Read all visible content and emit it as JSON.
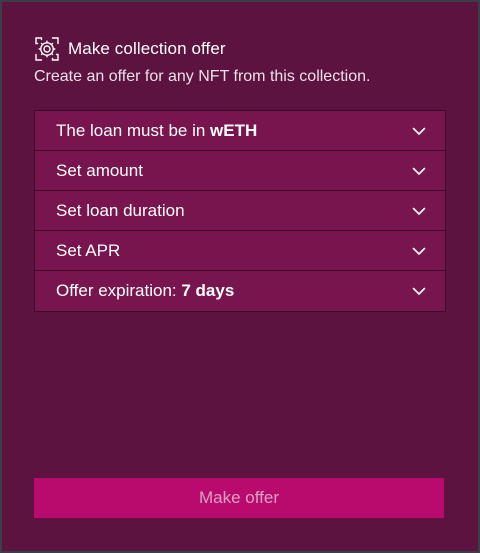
{
  "header": {
    "title": "Make collection offer",
    "subtitle": "Create an offer for any NFT from this collection.",
    "icon": "target-cog-icon"
  },
  "accordion": {
    "items": [
      {
        "label": "The loan must be in ",
        "value": "wETH",
        "icon": "chevron-down-icon"
      },
      {
        "label": "Set amount",
        "value": "",
        "icon": "chevron-down-icon"
      },
      {
        "label": "Set loan duration",
        "value": "",
        "icon": "chevron-down-icon"
      },
      {
        "label": "Set APR",
        "value": "",
        "icon": "chevron-down-icon"
      },
      {
        "label": "Offer expiration: ",
        "value": "7 days",
        "icon": "chevron-down-icon"
      }
    ]
  },
  "actions": {
    "submit_label": "Make offer"
  },
  "colors": {
    "background": "#5c1340",
    "item_background": "#78154f",
    "button_background": "#b90b6e",
    "button_text": "#dca0c3"
  }
}
